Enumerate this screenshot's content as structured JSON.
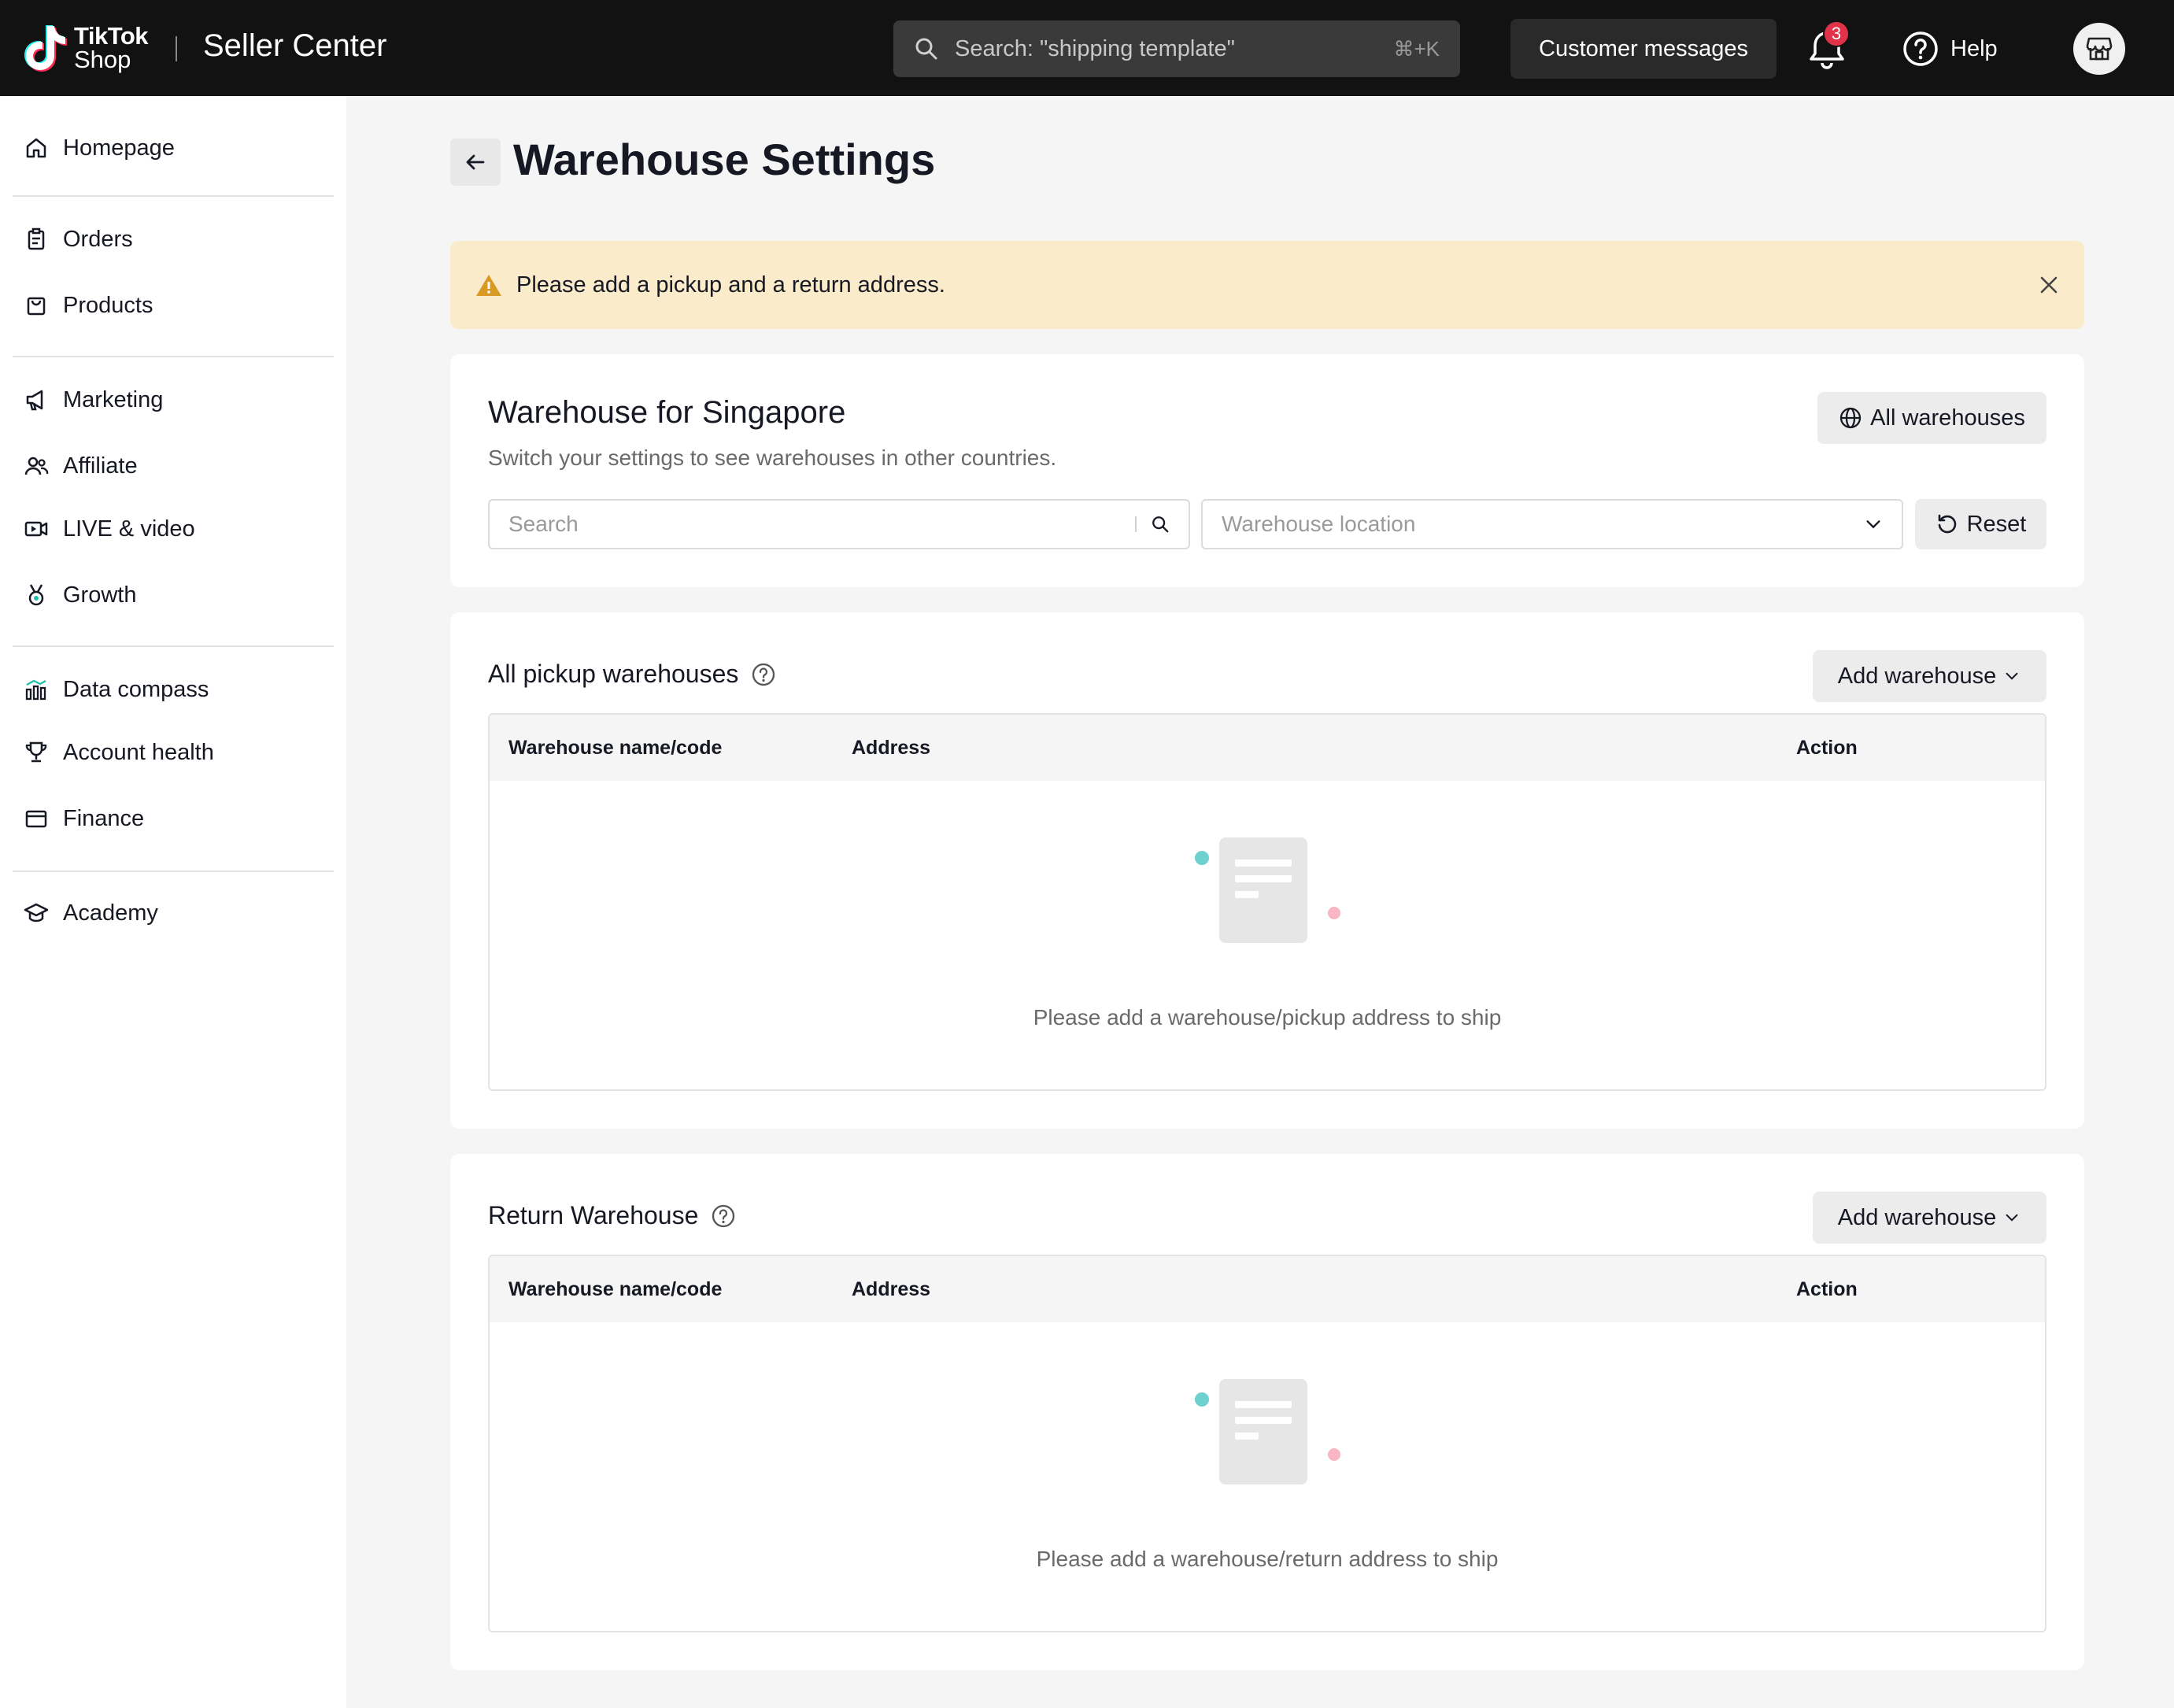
{
  "topbar": {
    "logo_line1": "TikTok",
    "logo_line2": "Shop",
    "brand": "Seller Center",
    "search_placeholder": "Search: \"shipping template\"",
    "search_shortcut": "⌘+K",
    "customer_messages": "Customer messages",
    "notification_count": "3",
    "help": "Help"
  },
  "sidebar": {
    "items": [
      {
        "label": "Homepage",
        "icon": "home-icon"
      },
      {
        "label": "Orders",
        "icon": "clipboard-icon"
      },
      {
        "label": "Products",
        "icon": "bag-icon"
      },
      {
        "label": "Marketing",
        "icon": "megaphone-icon"
      },
      {
        "label": "Affiliate",
        "icon": "users-icon"
      },
      {
        "label": "LIVE & video",
        "icon": "video-icon"
      },
      {
        "label": "Growth",
        "icon": "medal-icon"
      },
      {
        "label": "Data compass",
        "icon": "chart-icon"
      },
      {
        "label": "Account health",
        "icon": "trophy-icon"
      },
      {
        "label": "Finance",
        "icon": "card-icon"
      },
      {
        "label": "Academy",
        "icon": "grad-cap-icon"
      }
    ]
  },
  "page": {
    "title": "Warehouse Settings",
    "alert": "Please add a pickup and a return address."
  },
  "filter_card": {
    "title": "Warehouse for Singapore",
    "subtitle": "Switch your settings to see warehouses in other countries.",
    "all_warehouses": "All warehouses",
    "search_placeholder": "Search",
    "location_placeholder": "Warehouse location",
    "reset": "Reset"
  },
  "pickup": {
    "title": "All pickup warehouses",
    "add_button": "Add warehouse",
    "columns": [
      "Warehouse name/code",
      "Address",
      "Action"
    ],
    "empty_text": "Please add a warehouse/pickup address to ship"
  },
  "return": {
    "title": "Return Warehouse",
    "add_button": "Add warehouse",
    "columns": [
      "Warehouse name/code",
      "Address",
      "Action"
    ],
    "empty_text": "Please add a warehouse/return address to ship"
  },
  "colors": {
    "topbar": "#121212",
    "alert_bg": "#faebca",
    "warning": "#d89a24",
    "badge": "#e0334a",
    "dot_teal": "#6fd1cf",
    "dot_pink": "#f7b6c2"
  }
}
